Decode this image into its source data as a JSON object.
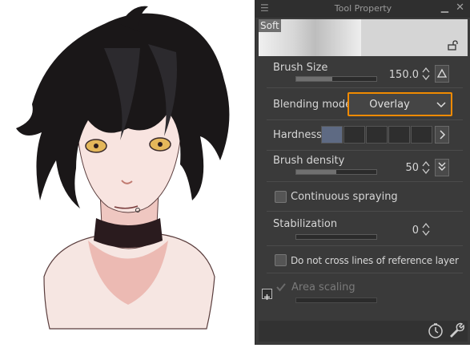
{
  "panel": {
    "title": "Tool Property",
    "preview_label": "Soft",
    "brush_size": {
      "label": "Brush Size",
      "value": "150.0",
      "fill_fraction": 0.45
    },
    "blending_mode": {
      "label": "Blending mode",
      "selected": "Overlay"
    },
    "hardness": {
      "label": "Hardness",
      "level": 1,
      "levels": 5
    },
    "brush_density": {
      "label": "Brush density",
      "value": "50",
      "fill_fraction": 0.5
    },
    "continuous_spraying": {
      "label": "Continuous spraying"
    },
    "stabilization": {
      "label": "Stabilization",
      "value": "0"
    },
    "no_cross_lines": {
      "label": "Do not cross lines of reference layer"
    },
    "area_scaling": {
      "label": "Area scaling"
    }
  },
  "colors": {
    "panel_bg": "#3a3a3a",
    "dropdown_highlight": "#f08a00",
    "hardness_active": "#5e6a83"
  },
  "icons": [
    "menu-icon",
    "minimize-icon",
    "close-icon",
    "lock-icon",
    "triangle-icon",
    "chevron-down-icon",
    "chevron-right-icon",
    "spinner-icon",
    "double-chevron-down-icon",
    "checkmark-icon",
    "plus-icon",
    "clock-icon",
    "wrench-icon"
  ]
}
